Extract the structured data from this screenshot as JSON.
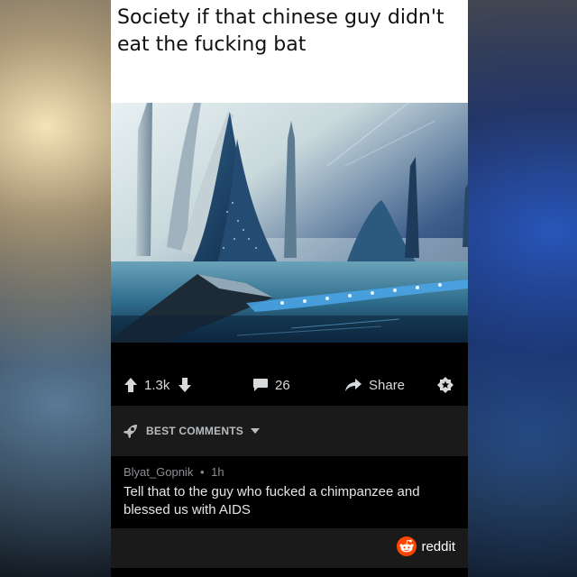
{
  "post": {
    "title": "Society if that chinese guy didn't eat the fucking bat"
  },
  "image": {
    "subject": "futuristic-city-illustration"
  },
  "actions": {
    "upvotes": "1.3k",
    "comments": "26",
    "share_label": "Share"
  },
  "comments_sort": {
    "label": "BEST COMMENTS"
  },
  "top_comment": {
    "author": "Blyat_Gopnik",
    "separator": "•",
    "age": "1h",
    "body": "Tell that to the guy who fucked a chimpanzee and blessed us with AIDS"
  },
  "footer": {
    "brand": "reddit"
  },
  "colors": {
    "reddit_orange": "#ff4500",
    "card_bg": "#000000",
    "bar_bg": "#1a1a1b",
    "text_light": "#d7dadc"
  }
}
